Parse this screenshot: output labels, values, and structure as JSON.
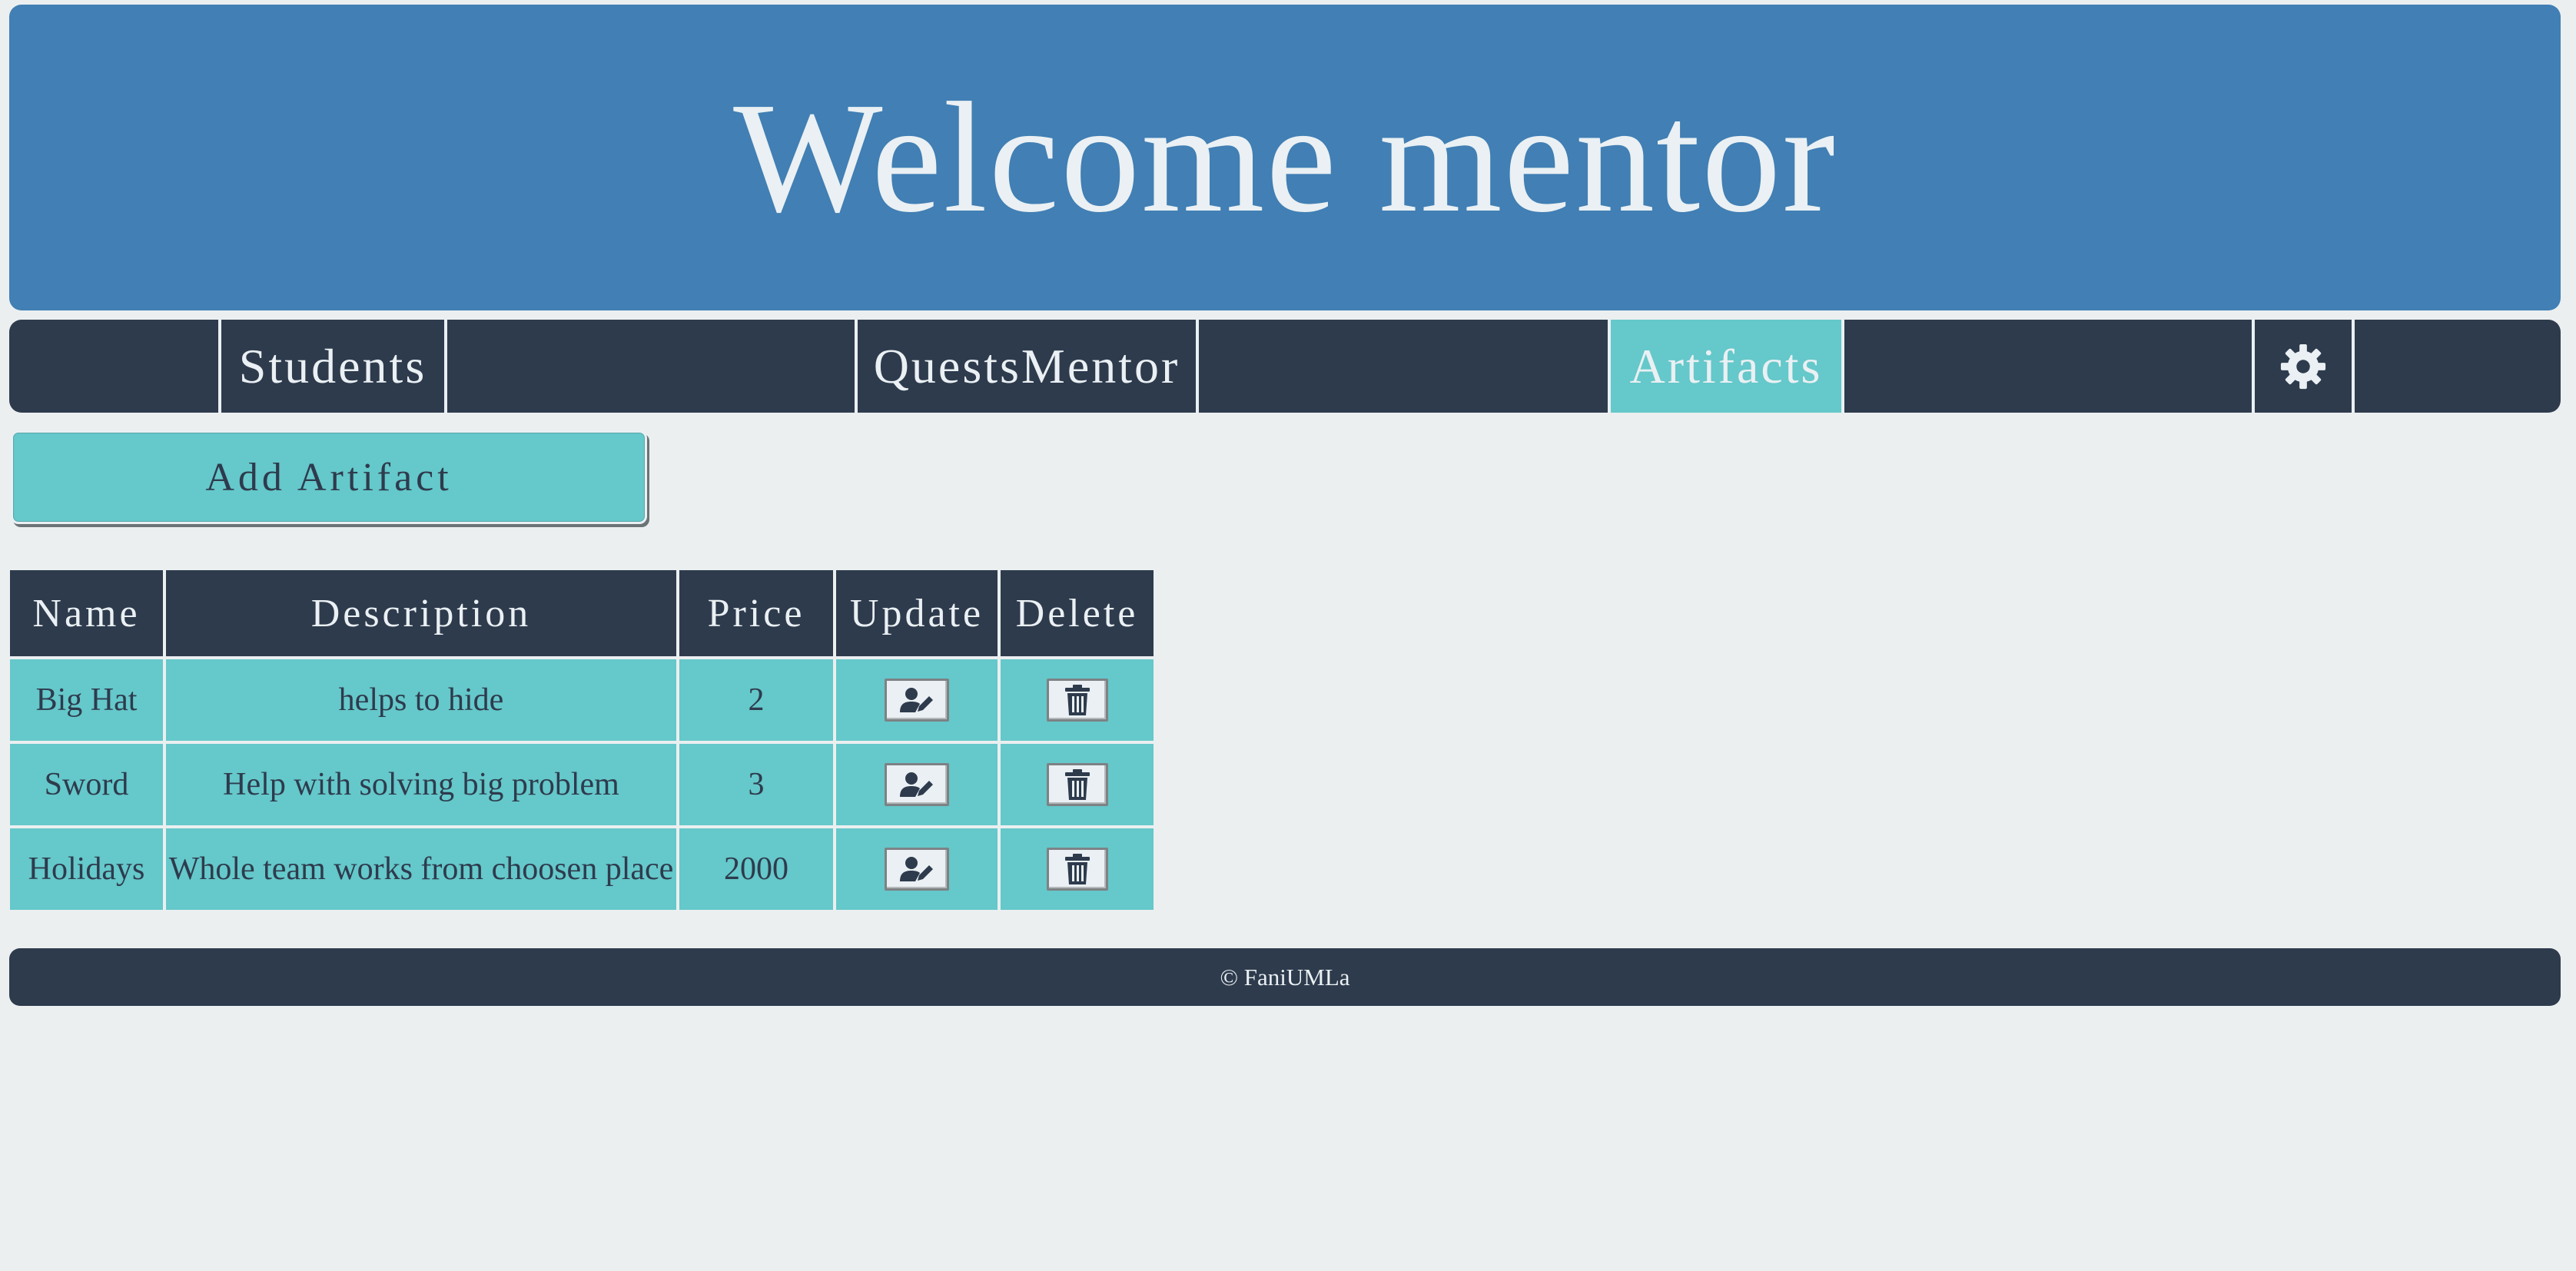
{
  "header": {
    "title": "Welcome mentor"
  },
  "nav": {
    "items": [
      {
        "label": "Students",
        "active": false
      },
      {
        "label": "QuestsMentor",
        "active": false
      },
      {
        "label": "Artifacts",
        "active": true
      }
    ],
    "settings_icon": "gear-icon"
  },
  "actions": {
    "add_label": "Add Artifact"
  },
  "table": {
    "headers": [
      "Name",
      "Description",
      "Price",
      "Update",
      "Delete"
    ],
    "rows": [
      {
        "name": "Big Hat",
        "description": "helps to hide",
        "price": "2"
      },
      {
        "name": "Sword",
        "description": "Help with solving big problem",
        "price": "3"
      },
      {
        "name": "Holidays",
        "description": "Whole team works from choosen place",
        "price": "2000"
      }
    ],
    "update_icon": "user-edit-icon",
    "delete_icon": "trash-icon"
  },
  "footer": {
    "text": "© FaniUMLa"
  },
  "colors": {
    "header_bg": "#417fb4",
    "nav_bg": "#2e3b4d",
    "accent": "#65c8ca",
    "page_bg": "#ebeff0",
    "text_light": "#eaf0f3"
  }
}
